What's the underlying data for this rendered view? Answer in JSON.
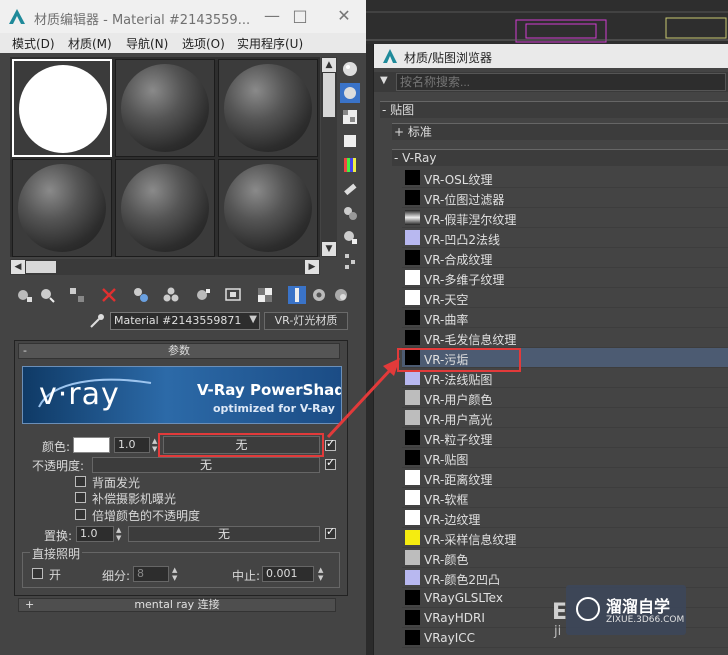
{
  "material_editor": {
    "title": "材质编辑器 - Material #2143559...",
    "menu": [
      "模式(D)",
      "材质(M)",
      "导航(N)",
      "选项(O)",
      "实用程序(U)"
    ],
    "material_name": "Material #2143559871",
    "material_type": "VR-灯光材质",
    "rollout_params": "参数",
    "rollout_minus": "-",
    "banner": {
      "logo": "v·ray",
      "title": "V-Ray PowerShader",
      "subtitle": "optimized for V-Ray"
    },
    "color_label": "颜色:",
    "color_value": "1.0",
    "color_map": "无",
    "opacity_label": "不透明度:",
    "opacity_map": "无",
    "opt_backside": "背面发光",
    "opt_compensate": "补偿摄影机曝光",
    "opt_multiply": "倍增颜色的不透明度",
    "displace_label": "置换:",
    "displace_value": "1.0",
    "displace_map": "无",
    "direct_group": "直接照明",
    "direct_on": "开",
    "subdiv_label": "细分:",
    "subdiv_value": "8",
    "cutoff_label": "中止:",
    "cutoff_value": "0.001",
    "mental_ray_plus": "+",
    "mental_ray": "mental ray 连接"
  },
  "browser": {
    "title": "材质/贴图浏览器",
    "search_placeholder": "按名称搜索...",
    "section_maps": "- 贴图",
    "section_standard": "+ 标准",
    "section_vray": "- V-Ray",
    "items": [
      {
        "name": "VR-OSL纹理",
        "swatch": "#000000"
      },
      {
        "name": "VR-位图过滤器",
        "swatch": "#000000"
      },
      {
        "name": "VR-假菲涅尔纹理",
        "swatch": "gradient"
      },
      {
        "name": "VR-凹凸2法线",
        "swatch": "#b8b8f0"
      },
      {
        "name": "VR-合成纹理",
        "swatch": "#000000"
      },
      {
        "name": "VR-多维子纹理",
        "swatch": "#ffffff"
      },
      {
        "name": "VR-天空",
        "swatch": "#ffffff"
      },
      {
        "name": "VR-曲率",
        "swatch": "#000000"
      },
      {
        "name": "VR-毛发信息纹理",
        "swatch": "#000000"
      },
      {
        "name": "VR-污垢",
        "swatch": "#000000"
      },
      {
        "name": "VR-法线贴图",
        "swatch": "#b8b8f0"
      },
      {
        "name": "VR-用户颜色",
        "swatch": "#bdbdbd"
      },
      {
        "name": "VR-用户高光",
        "swatch": "#bdbdbd"
      },
      {
        "name": "VR-粒子纹理",
        "swatch": "#000000"
      },
      {
        "name": "VR-贴图",
        "swatch": "#000000"
      },
      {
        "name": "VR-距离纹理",
        "swatch": "#ffffff"
      },
      {
        "name": "VR-软框",
        "swatch": "#ffffff"
      },
      {
        "name": "VR-边纹理",
        "swatch": "#ffffff"
      },
      {
        "name": "VR-采样信息纹理",
        "swatch": "#f5ec10"
      },
      {
        "name": "VR-颜色",
        "swatch": "#bdbdbd"
      },
      {
        "name": "VR-颜色2凹凸",
        "swatch": "#b8b8f0"
      },
      {
        "name": "VRayGLSLTex",
        "swatch": "#000000"
      },
      {
        "name": "VRayHDRI",
        "swatch": "#000000"
      },
      {
        "name": "VRayICC",
        "swatch": "#000000"
      }
    ],
    "selected_index": 9
  },
  "watermark": {
    "title": "溜溜自学",
    "url": "ZIXUE.3D66.COM",
    "e_letter": "E",
    "j_letter": "ji"
  },
  "colors": {
    "highlight": "#e23a3a",
    "selected_row": "#4c5b72",
    "ui_dark": "#444444"
  }
}
